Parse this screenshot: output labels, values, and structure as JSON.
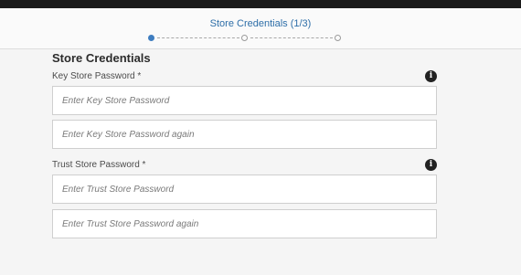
{
  "wizard": {
    "step_title": "Store Credentials (1/3)",
    "steps": [
      {
        "state": "active"
      },
      {
        "state": "inactive"
      },
      {
        "state": "inactive"
      }
    ]
  },
  "form": {
    "section_title": "Store Credentials",
    "key_store": {
      "label": "Key Store Password *",
      "info_icon": "info-icon",
      "password_placeholder": "Enter Key Store Password",
      "confirm_placeholder": "Enter Key Store Password again"
    },
    "trust_store": {
      "label": "Trust Store Password *",
      "info_icon": "info-icon",
      "password_placeholder": "Enter Trust Store Password",
      "confirm_placeholder": "Enter Trust Store Password again"
    }
  },
  "colors": {
    "accent": "#2d6ea8",
    "active_step": "#3e7dc0",
    "top_bar": "#1c1c1c"
  }
}
